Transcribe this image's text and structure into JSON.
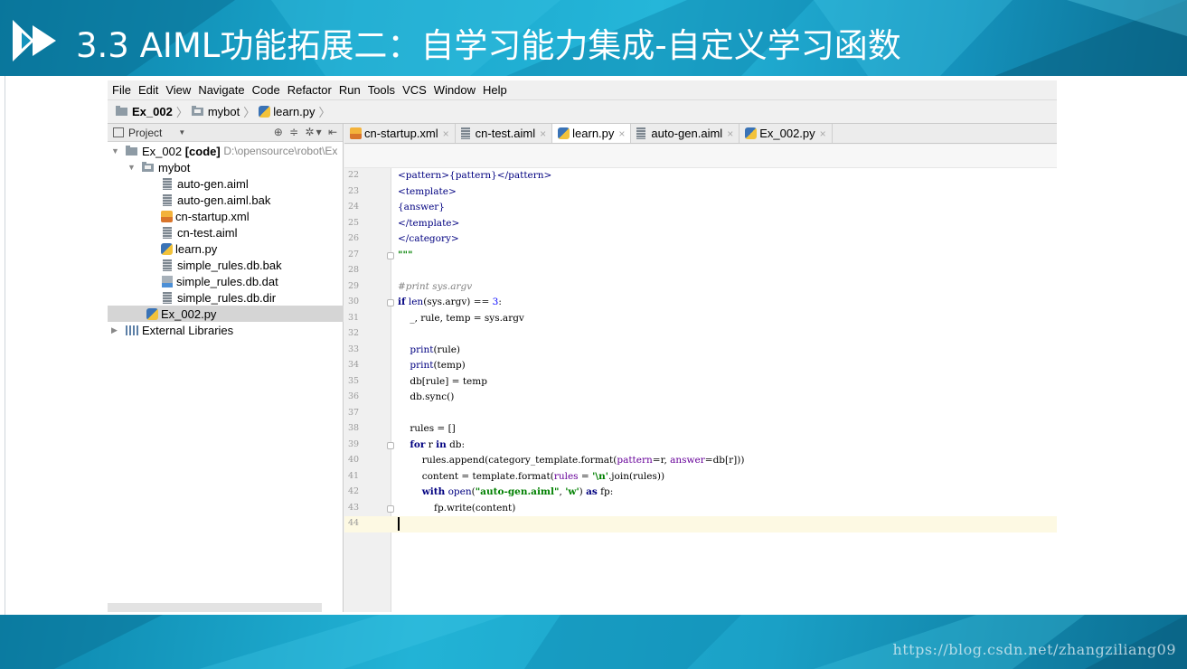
{
  "slide": {
    "title": "3.3 AIML功能拓展二：自学习能力集成-自定义学习函数",
    "watermark": "https://blog.csdn.net/zhangziliang09"
  },
  "menu": [
    "File",
    "Edit",
    "View",
    "Navigate",
    "Code",
    "Refactor",
    "Run",
    "Tools",
    "VCS",
    "Window",
    "Help"
  ],
  "nav": {
    "project": "Ex_002",
    "folder": "mybot",
    "file": "learn.py"
  },
  "project_panel": {
    "header": "Project",
    "root_name": "Ex_002",
    "root_tag": "[code]",
    "root_path": "D:\\opensource\\robot\\Ex",
    "folder": "mybot",
    "files": [
      {
        "name": "auto-gen.aiml",
        "icon": "aiml-file-icon"
      },
      {
        "name": "auto-gen.aiml.bak",
        "icon": "text-file-icon"
      },
      {
        "name": "cn-startup.xml",
        "icon": "xml-file-icon"
      },
      {
        "name": "cn-test.aiml",
        "icon": "aiml-file-icon"
      },
      {
        "name": "learn.py",
        "icon": "python-file-icon"
      },
      {
        "name": "simple_rules.db.bak",
        "icon": "text-file-icon"
      },
      {
        "name": "simple_rules.db.dat",
        "icon": "unknown-file-icon"
      },
      {
        "name": "simple_rules.db.dir",
        "icon": "text-file-icon"
      }
    ],
    "selected_file": "Ex_002.py",
    "external": "External Libraries"
  },
  "tabs": [
    {
      "label": "cn-startup.xml",
      "icon": "xml-file-icon",
      "active": false
    },
    {
      "label": "cn-test.aiml",
      "icon": "aiml-file-icon",
      "active": false
    },
    {
      "label": "learn.py",
      "icon": "python-file-icon",
      "active": true
    },
    {
      "label": "auto-gen.aiml",
      "icon": "aiml-file-icon",
      "active": false
    },
    {
      "label": "Ex_002.py",
      "icon": "python-file-icon",
      "active": false
    }
  ],
  "code_lines": [
    {
      "n": "22",
      "html": "<span class=\"tag\">&lt;pattern&gt;{pattern}&lt;/pattern&gt;</span>"
    },
    {
      "n": "23",
      "html": "<span class=\"tag\">&lt;template&gt;</span>"
    },
    {
      "n": "24",
      "html": "<span class=\"tag\">{answer}</span>"
    },
    {
      "n": "25",
      "html": "<span class=\"tag\">&lt;/template&gt;</span>"
    },
    {
      "n": "26",
      "html": "<span class=\"tag\">&lt;/category&gt;</span>"
    },
    {
      "n": "27",
      "html": "<span class=\"str\">\"\"\"</span>"
    },
    {
      "n": "28",
      "html": ""
    },
    {
      "n": "29",
      "html": "<span class=\"cm\">#print sys.argv</span>"
    },
    {
      "n": "30",
      "html": "<span class=\"kw\">if</span> <span class=\"tag\">len</span>(sys.argv) == <span class=\"num\">3</span>:"
    },
    {
      "n": "31",
      "html": "    _, rule, temp = sys.argv"
    },
    {
      "n": "32",
      "html": ""
    },
    {
      "n": "33",
      "html": "    <span class=\"tag\">print</span>(rule)"
    },
    {
      "n": "34",
      "html": "    <span class=\"tag\">print</span>(temp)"
    },
    {
      "n": "35",
      "html": "    db[rule] = temp"
    },
    {
      "n": "36",
      "html": "    db.sync()"
    },
    {
      "n": "37",
      "html": ""
    },
    {
      "n": "38",
      "html": "    rules = []"
    },
    {
      "n": "39",
      "html": "    <span class=\"kw\">for</span> r <span class=\"kw\">in</span> db:"
    },
    {
      "n": "40",
      "html": "        rules.append(category_template.format(<span class=\"par\">pattern</span>=r, <span class=\"par\">answer</span>=db[r]))"
    },
    {
      "n": "41",
      "html": "        content = template.format(<span class=\"par\">rules</span> = <span class=\"str\">'\\n'</span>.join(rules))"
    },
    {
      "n": "42",
      "html": "        <span class=\"kw\">with</span> <span class=\"tag\">open</span>(<span class=\"str\">\"auto-gen.aiml\"</span>, <span class=\"str\">'w'</span>) <span class=\"kw\">as</span> fp:"
    },
    {
      "n": "43",
      "html": "            fp.write(content)"
    },
    {
      "n": "44",
      "html": ""
    }
  ],
  "current_line": "44"
}
